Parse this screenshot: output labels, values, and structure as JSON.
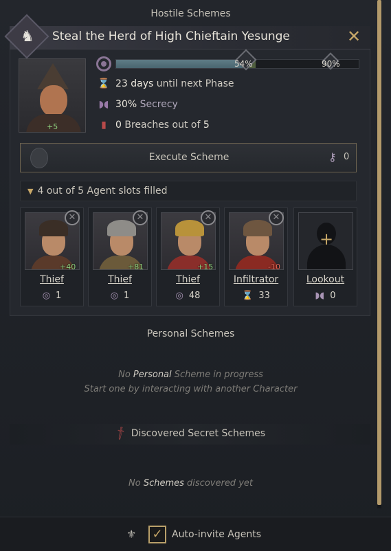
{
  "header": {
    "title": "Hostile Schemes"
  },
  "scheme": {
    "title": "Steal the Herd of High Chieftain Yesunge",
    "close_glyph": "✕",
    "target_icon": "horse-head-icon",
    "target_opinion": "+5",
    "progress": {
      "current_percent": "54%",
      "target_percent": "90%",
      "current_value": 54,
      "target_value": 90
    },
    "phase": {
      "value": "23 days",
      "text": " until next Phase"
    },
    "secrecy": {
      "value": "30%",
      "label": " Secrecy"
    },
    "breaches": {
      "prefix": "0",
      "text": " Breaches out of ",
      "max": "5"
    },
    "execute": {
      "label": "Execute Scheme",
      "key_count": "0"
    },
    "slots": {
      "filled": "4",
      "text_mid": " out of ",
      "total": "5",
      "text_end": " Agent slots filled"
    },
    "agents": [
      {
        "role": "Thief",
        "stat": "1",
        "stat_icon": "success-icon",
        "opinion": "+40",
        "opinion_color": "#8fd37f",
        "hat": "#3a2e26",
        "clothing": "#5a3a2a",
        "remove_glyph": "✕"
      },
      {
        "role": "Thief",
        "stat": "1",
        "stat_icon": "success-icon",
        "opinion": "+81",
        "opinion_color": "#8fd37f",
        "hat": "#8e8c88",
        "clothing": "#6b5a3a",
        "remove_glyph": "✕"
      },
      {
        "role": "Thief",
        "stat": "48",
        "stat_icon": "success-icon",
        "opinion": "+15",
        "opinion_color": "#8fd37f",
        "hat": "#b8923a",
        "clothing": "#8a2e2a",
        "remove_glyph": "✕"
      },
      {
        "role": "Infiltrator",
        "stat": "33",
        "stat_icon": "hourglass-icon",
        "opinion": "-10",
        "opinion_color": "#e06a5a",
        "hat": "#6e5640",
        "clothing": "#8a2a22",
        "remove_glyph": "✕"
      }
    ],
    "lookout": {
      "role": "Lookout",
      "stat": "0",
      "stat_icon": "mask-icon",
      "plus_glyph": "+"
    }
  },
  "personal": {
    "title": "Personal Schemes",
    "empty_prefix": "No ",
    "empty_bold": "Personal",
    "empty_mid": " Scheme",
    "empty_suffix": " in progress",
    "empty_sub": "Start one by interacting with another Character"
  },
  "secret": {
    "title": "Discovered Secret Schemes",
    "empty_prefix": "No ",
    "empty_bold": "Schemes",
    "empty_suffix": " discovered yet"
  },
  "footer": {
    "checkbox_glyph": "✓",
    "label": "Auto-invite Agents",
    "checked": true
  },
  "colors": {
    "accent_gold": "#c8a868",
    "secrecy_purple": "#9a7aa8",
    "breach_red": "#b84a4a"
  }
}
